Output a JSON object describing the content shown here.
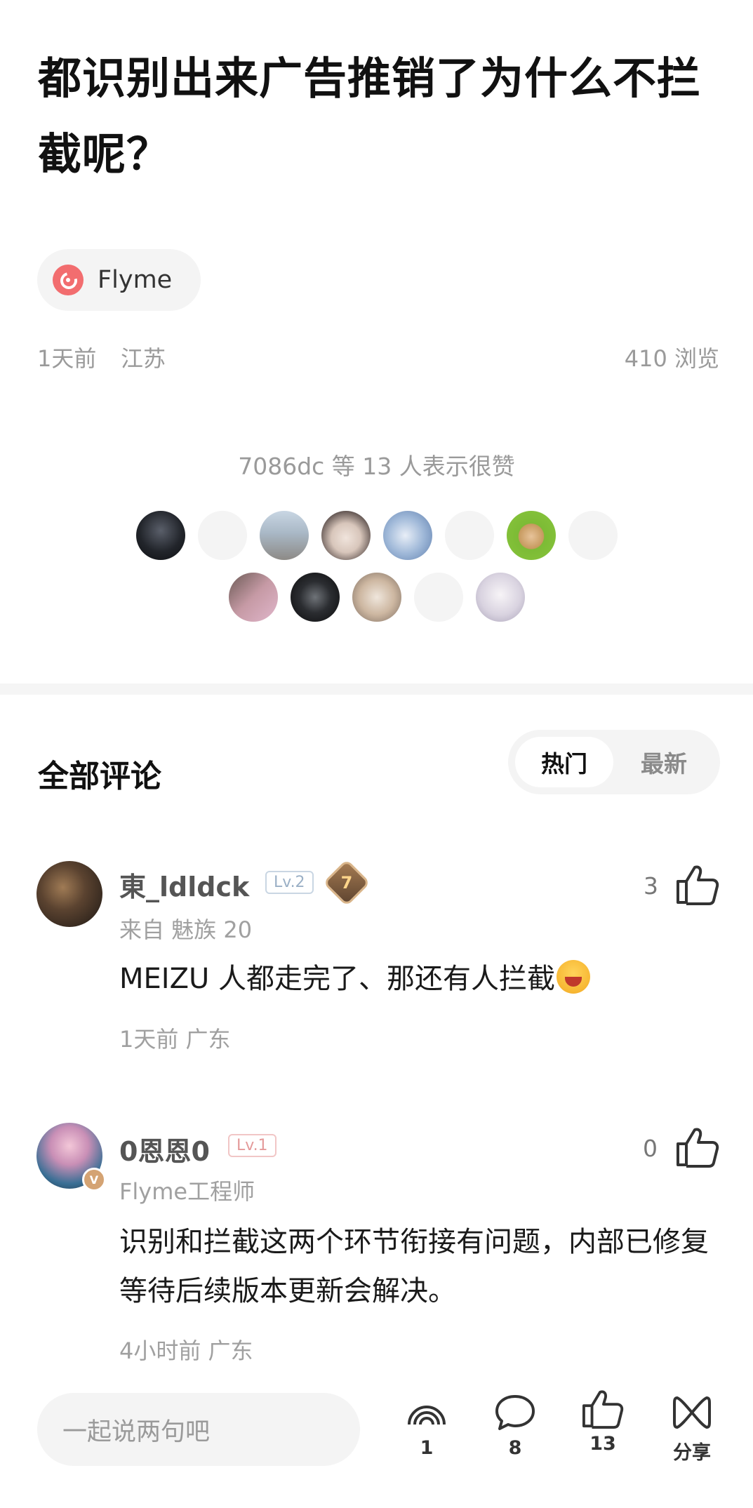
{
  "post": {
    "title": "都识别出来广告推销了为什么不拦截呢？",
    "topic": {
      "label": "Flyme",
      "icon": "flyme-logo-icon",
      "icon_color": "#f26d6f"
    },
    "time": "1天前",
    "location": "江苏",
    "views": "410 浏览"
  },
  "likes": {
    "summary": "7086dc 等 13 人表示很赞",
    "avatar_count": 13
  },
  "comments_section": {
    "title": "全部评论",
    "sort": {
      "hot": "热门",
      "new": "最新",
      "selected": "热门"
    }
  },
  "comments": [
    {
      "name": "東_ldldck",
      "level": "Lv.2",
      "medal": "7",
      "sub": "来自 魅族 20",
      "text": "MEIZU 人都走完了、那还有人拦截",
      "emoji": "laughing-crying-emoji",
      "time": "1天前  广东",
      "likes": "3"
    },
    {
      "name": "0恩恩0",
      "level": "Lv.1",
      "verified": "V",
      "sub": "Flyme工程师",
      "text": "识别和拦截这两个环节衔接有问题，内部已修复等待后续版本更新会解决。",
      "time": "4小时前  广东",
      "likes": "0"
    }
  ],
  "bottom_bar": {
    "input_placeholder": "一起说两句吧",
    "collect_count": "1",
    "comment_count": "8",
    "like_count": "13",
    "share_label": "分享"
  }
}
